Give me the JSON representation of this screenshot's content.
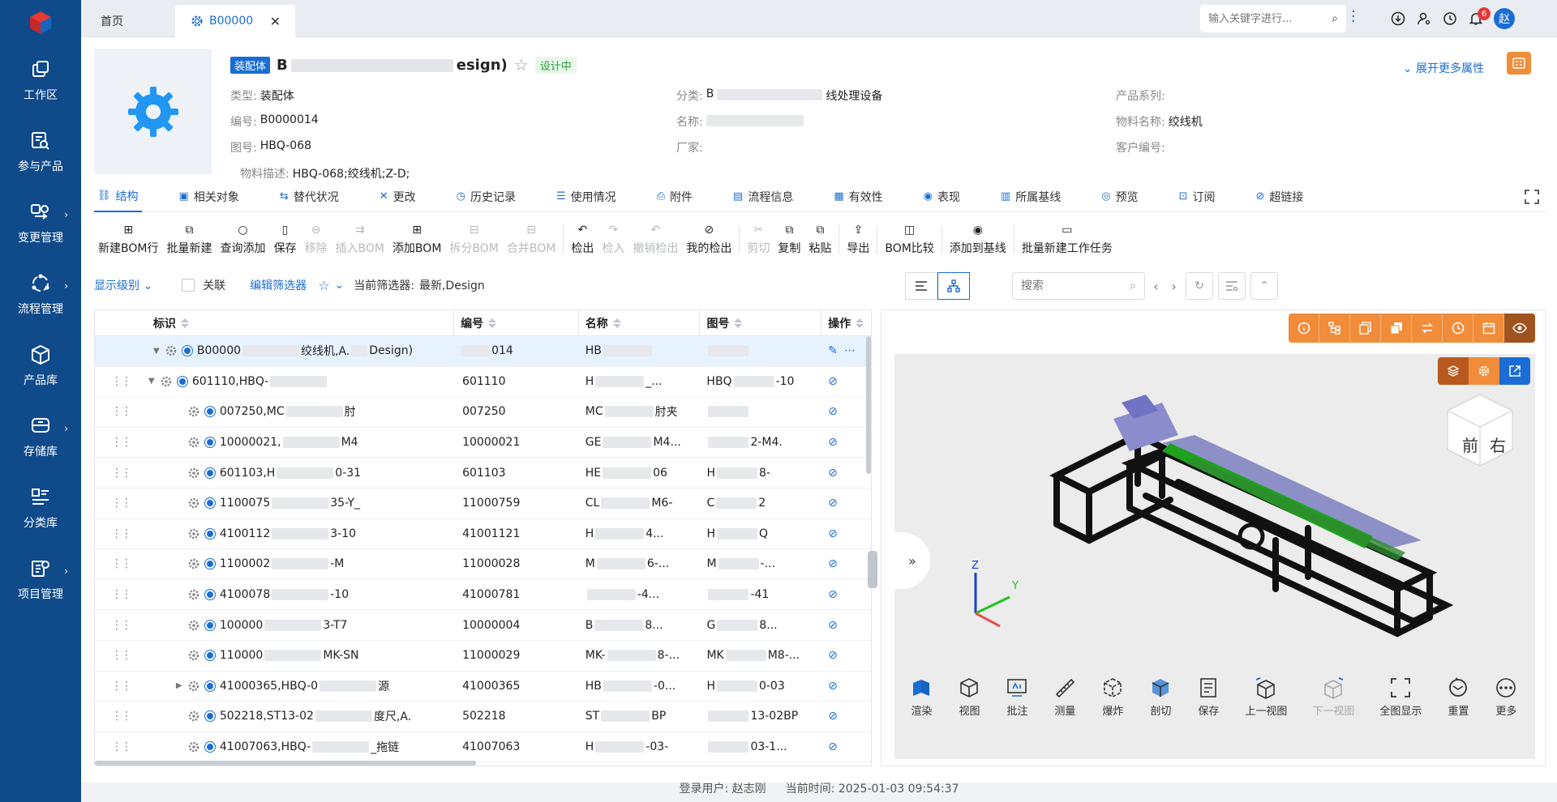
{
  "sidebar": {
    "items": [
      {
        "label": "工作区",
        "icon": "workspace-icon",
        "has_submenu": false
      },
      {
        "label": "参与产品",
        "icon": "product-search-icon",
        "has_submenu": false
      },
      {
        "label": "变更管理",
        "icon": "change-icon",
        "has_submenu": true
      },
      {
        "label": "流程管理",
        "icon": "workflow-icon",
        "has_submenu": true
      },
      {
        "label": "产品库",
        "icon": "cube-icon",
        "has_submenu": false
      },
      {
        "label": "存储库",
        "icon": "storage-icon",
        "has_submenu": true
      },
      {
        "label": "分类库",
        "icon": "category-icon",
        "has_submenu": false
      },
      {
        "label": "项目管理",
        "icon": "project-icon",
        "has_submenu": true
      }
    ]
  },
  "topbar": {
    "tabs": [
      {
        "label": "首页"
      },
      {
        "label": "B00000"
      }
    ],
    "search_placeholder": "输入关键字进行...",
    "notification_count": "6",
    "avatar": "赵"
  },
  "header": {
    "type_tag": "装配体",
    "title_start": "B",
    "title_end": "esign)",
    "status": "设计中",
    "expand_label": "展开更多属性",
    "attrs": [
      {
        "k": "类型:",
        "v": "装配体"
      },
      {
        "k": "编号:",
        "v": "B0000014"
      },
      {
        "k": "图号:",
        "v": "HBQ-068"
      },
      {
        "k": "物料描述:",
        "v": "HBQ-068;绞线机;Z-D;"
      },
      {
        "k": "分类:",
        "v": "B",
        "v2": "线处理设备"
      },
      {
        "k": "名称:",
        "v": ""
      },
      {
        "k": "厂家:",
        "v": ""
      },
      {
        "k": "产品系列:",
        "v": ""
      },
      {
        "k": "物料名称:",
        "v": "绞线机"
      },
      {
        "k": "客户编号:",
        "v": ""
      }
    ]
  },
  "tabs": [
    "结构",
    "相关对象",
    "替代状况",
    "更改",
    "历史记录",
    "使用情况",
    "附件",
    "流程信息",
    "有效性",
    "表现",
    "所属基线",
    "预览",
    "订阅",
    "超链接"
  ],
  "toolbar": [
    {
      "label": "新建BOM行",
      "disabled": false
    },
    {
      "label": "批量新建",
      "disabled": false
    },
    {
      "label": "查询添加",
      "disabled": false
    },
    {
      "label": "保存",
      "disabled": false
    },
    {
      "label": "移除",
      "disabled": true
    },
    {
      "label": "插入BOM",
      "disabled": true
    },
    {
      "label": "添加BOM",
      "disabled": false
    },
    {
      "label": "拆分BOM",
      "disabled": true
    },
    {
      "label": "合并BOM",
      "disabled": true
    },
    {
      "label": "检出",
      "disabled": false
    },
    {
      "label": "检入",
      "disabled": true
    },
    {
      "label": "撤销检出",
      "disabled": true
    },
    {
      "label": "我的检出",
      "disabled": false
    },
    {
      "label": "剪切",
      "disabled": true
    },
    {
      "label": "复制",
      "disabled": false
    },
    {
      "label": "粘贴",
      "disabled": false
    },
    {
      "label": "导出",
      "disabled": false
    },
    {
      "label": "BOM比较",
      "disabled": false
    },
    {
      "label": "添加到基线",
      "disabled": false
    },
    {
      "label": "批量新建工作任务",
      "disabled": false
    }
  ],
  "filter": {
    "level_label": "显示级别",
    "relate_label": "关联",
    "edit_filter": "编辑筛选器",
    "current_filter_label": "当前筛选器:",
    "current_filter_value": "最新,Design",
    "search_placeholder": "搜索"
  },
  "table": {
    "columns": [
      "标识",
      "编号",
      "名称",
      "图号",
      "操作"
    ],
    "rows": [
      {
        "id": "B00000",
        "id_end": "绞线机,A.",
        "id_end2": "Design)",
        "no": "014",
        "name": "HB",
        "dwg": "",
        "level": 0,
        "expand": "open",
        "sel": true
      },
      {
        "id": "601110,HBQ-",
        "id_end": "",
        "no": "601110",
        "name": "H",
        "name2": "_...",
        "dwg": "HBQ",
        "dwg2": "-10",
        "level": 1,
        "expand": "open"
      },
      {
        "id": "007250,MC",
        "id_end": "肘",
        "no": "007250",
        "name": "MC",
        "name2": "肘夹",
        "dwg": "",
        "level": 2
      },
      {
        "id": "10000021,",
        "id_end": "M4",
        "no": "10000021",
        "name": "GE",
        "name2": "M4...",
        "dwg": "",
        "dwg2": "2-M4.",
        "level": 2
      },
      {
        "id": "601103,H",
        "id_end": "0-31",
        "no": "601103",
        "name": "HE",
        "name2": "06",
        "dwg": "H",
        "dwg2": "8-",
        "level": 2
      },
      {
        "id": "1100075",
        "id_end": "35-Y_",
        "no": "11000759",
        "name": "CL",
        "name2": "M6-",
        "dwg": "C",
        "dwg2": "2",
        "level": 2
      },
      {
        "id": "4100112",
        "id_end": "3-10",
        "no": "41001121",
        "name": "H",
        "name2": "4...",
        "dwg": "H",
        "dwg2": "Q",
        "level": 2
      },
      {
        "id": "1100002",
        "id_end": "-M",
        "no": "11000028",
        "name": "M",
        "name2": "6-...",
        "dwg": "M",
        "dwg2": "-...",
        "level": 2
      },
      {
        "id": "4100078",
        "id_end": "-10",
        "no": "41000781",
        "name": "",
        "name2": "-4...",
        "dwg": "",
        "dwg2": "-41",
        "level": 2
      },
      {
        "id": "100000",
        "id_end": "3-T7",
        "no": "10000004",
        "name": "B",
        "name2": "8...",
        "dwg": "G",
        "dwg2": "8...",
        "level": 2
      },
      {
        "id": "110000",
        "id_end": "MK-SN",
        "no": "11000029",
        "name": "MK-",
        "name2": "8-...",
        "dwg": "MK",
        "dwg2": "M8-...",
        "level": 2
      },
      {
        "id": "41000365,HBQ-0",
        "id_end": "源",
        "no": "41000365",
        "name": "HB",
        "name2": "-0...",
        "dwg": "H",
        "dwg2": "0-03",
        "level": 2,
        "expand": "closed"
      },
      {
        "id": "502218,ST13-02",
        "id_end": "度尺,A.",
        "no": "502218",
        "name": "ST",
        "name2": "BP",
        "dwg": "",
        "dwg2": "13-02BP",
        "level": 2
      },
      {
        "id": "41007063,HBQ-",
        "id_end": "_拖链",
        "no": "41007063",
        "name": "H",
        "name2": "-03-",
        "dwg": "",
        "dwg2": "03-1...",
        "level": 2
      }
    ]
  },
  "viewer": {
    "tools": [
      "渲染",
      "视图",
      "批注",
      "测量",
      "爆炸",
      "剖切",
      "保存",
      "上一视图",
      "下一视图",
      "全图显示",
      "重置",
      "更多"
    ],
    "dim_tools": [
      "下一视图"
    ],
    "cube_labels": [
      "前",
      "右"
    ],
    "axis_labels": [
      "Z",
      "Y"
    ]
  },
  "footer": {
    "user_label": "登录用户:",
    "user": "赵志刚",
    "time_label": "当前时间:",
    "time": "2025-01-03 09:54:37"
  },
  "colors": {
    "sidebar": "#0f4a8a",
    "accent": "#1a6dd4",
    "orange": "#f08c3a"
  }
}
